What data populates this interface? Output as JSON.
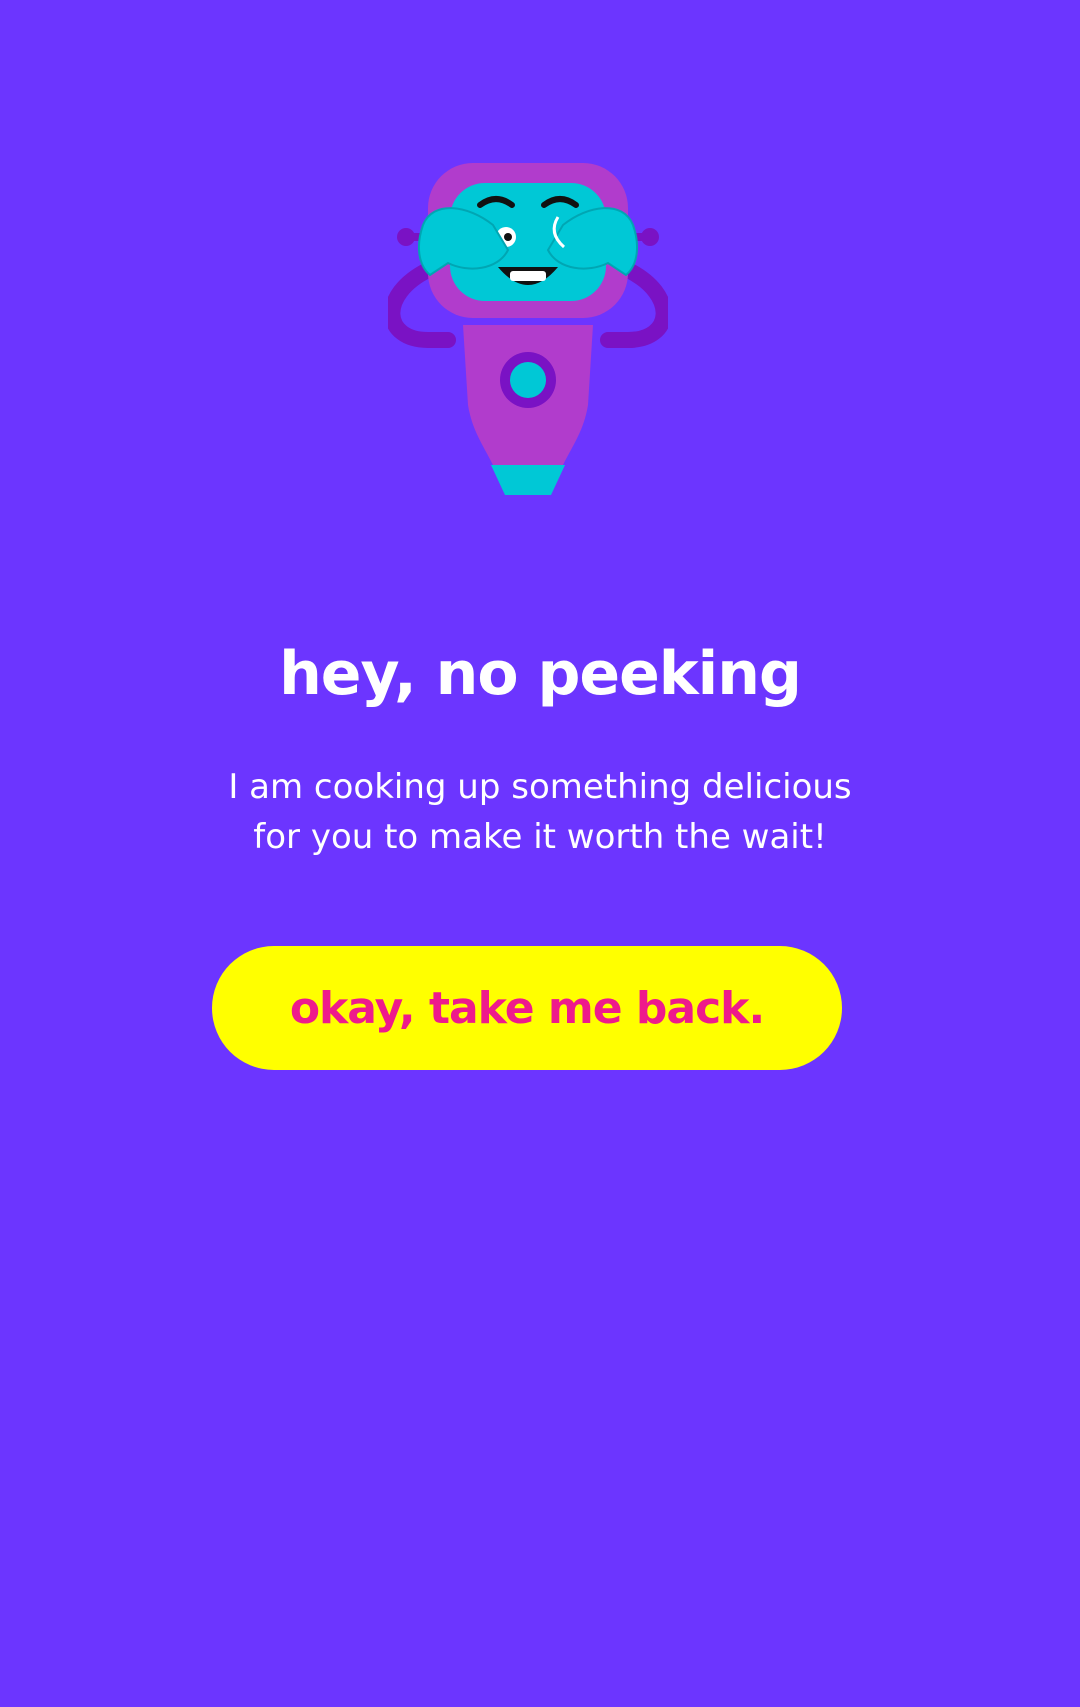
{
  "colors": {
    "background": "#6c35ff",
    "title_text": "#ffffff",
    "button_background": "#ffff00",
    "button_text": "#ee1a8c",
    "robot_body": "#b13ccc",
    "robot_face": "#00c8d6",
    "robot_accent": "#7a12c4"
  },
  "illustration": {
    "icon": "robot-covering-eyes-icon"
  },
  "main": {
    "title": "hey, no peeking",
    "message_line1": "I am cooking up something delicious",
    "message_line2": "for you to make it worth the wait!",
    "button_label": "okay, take me back."
  }
}
